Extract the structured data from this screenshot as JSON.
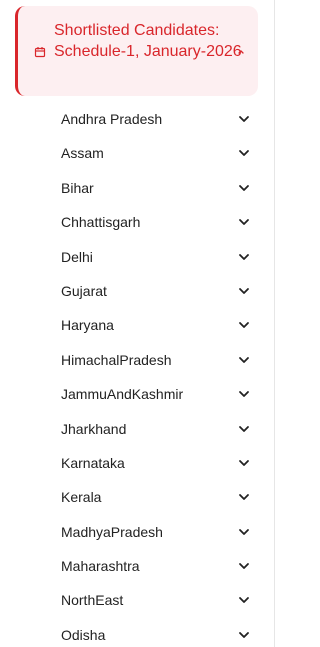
{
  "header": {
    "title": "Shortlisted Candidates: Schedule-1, January-2026",
    "icon": "calendar-icon",
    "toggle_icon": "chevron-up-icon",
    "accent_color": "#d9262b",
    "background_color": "#fdeff1"
  },
  "states": [
    {
      "label": "Andhra Pradesh"
    },
    {
      "label": "Assam"
    },
    {
      "label": "Bihar"
    },
    {
      "label": "Chhattisgarh"
    },
    {
      "label": "Delhi"
    },
    {
      "label": "Gujarat"
    },
    {
      "label": "Haryana"
    },
    {
      "label": "HimachalPradesh"
    },
    {
      "label": "JammuAndKashmir"
    },
    {
      "label": "Jharkhand"
    },
    {
      "label": "Karnataka"
    },
    {
      "label": "Kerala"
    },
    {
      "label": "MadhyaPradesh"
    },
    {
      "label": "Maharashtra"
    },
    {
      "label": "NorthEast"
    },
    {
      "label": "Odisha"
    }
  ],
  "item_toggle_icon": "chevron-down-icon"
}
